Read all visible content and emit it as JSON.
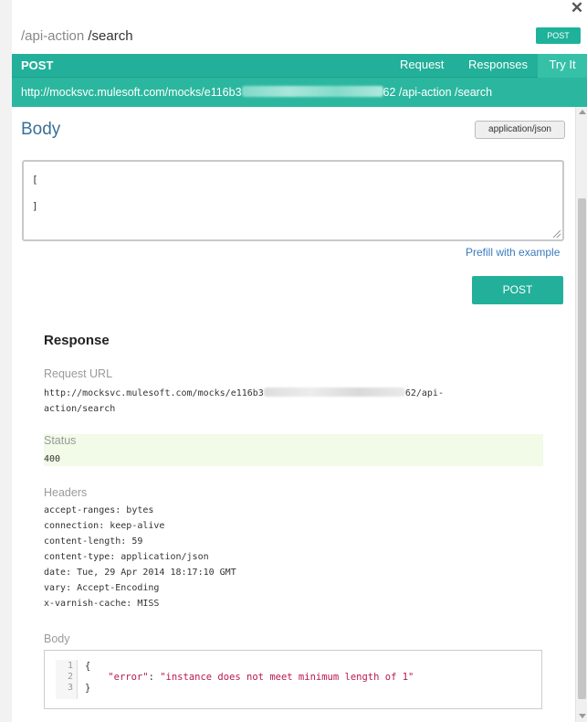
{
  "header": {
    "resource_path": "/api-action",
    "method_path": " /search",
    "method_badge": "POST"
  },
  "tabs_bar": {
    "method": "POST",
    "tabs": [
      {
        "label": "Request"
      },
      {
        "label": "Responses"
      },
      {
        "label": "Try It"
      }
    ]
  },
  "url_bar": {
    "url_prefix": "http://mocksvc.mulesoft.com/mocks/e116b3",
    "url_suffix": "62 /api-action /search"
  },
  "body_section": {
    "title": "Body",
    "mime_type": "application/json",
    "editor_line1": "[",
    "editor_line2": "]",
    "prefill_link": "Prefill with example",
    "post_button": "POST"
  },
  "response": {
    "title": "Response",
    "request_url_label": "Request URL",
    "request_url_prefix": "http://mocksvc.mulesoft.com/mocks/e116b3",
    "request_url_suffix": "62/api-",
    "request_url_line2": "action/search",
    "status_label": "Status",
    "status_value": "400",
    "headers_label": "Headers",
    "headers": [
      "accept-ranges: bytes",
      "connection: keep-alive",
      "content-length: 59",
      "content-type: application/json",
      "date: Tue, 29 Apr 2014 18:17:10 GMT",
      "vary: Accept-Encoding",
      "x-varnish-cache: MISS"
    ],
    "body_label": "Body",
    "body_lines": {
      "line1": "{",
      "line2_key": "\"error\"",
      "line2_sep": ": ",
      "line2_value": "\"instance does not meet minimum length of 1\"",
      "line3": "}"
    },
    "line_numbers": [
      "1",
      "2",
      "3"
    ]
  }
}
